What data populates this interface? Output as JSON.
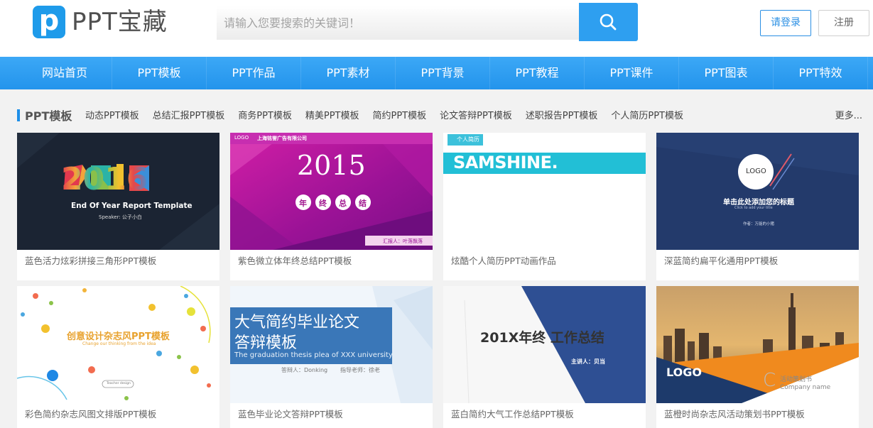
{
  "header": {
    "logo_letter": "p",
    "logo_text": "PPT宝藏",
    "search_placeholder": "请输入您要搜索的关键词！",
    "login_label": "请登录",
    "register_label": "注册"
  },
  "nav": {
    "items": [
      "网站首页",
      "PPT模板",
      "PPT作品",
      "PPT素材",
      "PPT背景",
      "PPT教程",
      "PPT课件",
      "PPT图表",
      "PPT特效"
    ]
  },
  "category": {
    "title": "PPT模板",
    "links": [
      "动态PPT模板",
      "总结汇报PPT模板",
      "商务PPT模板",
      "精美PPT模板",
      "简约PPT模板",
      "论文答辩PPT模板",
      "述职报告PPT模板",
      "个人简历PPT模板"
    ],
    "more": "更多..."
  },
  "cards": [
    {
      "title": "蓝色活力炫彩拼接三角形PPT模板",
      "thumb": {
        "big": "2016",
        "line1": "End Of Year Report Template",
        "line2": "Speaker: 公子小白"
      }
    },
    {
      "title": "紫色微立体年终总结PPT模板",
      "thumb": {
        "logo": "LOGO",
        "company": "上海铭誉广告有限公司",
        "year": "2015",
        "chars": [
          "年",
          "终",
          "总",
          "结"
        ],
        "reporter": "汇报人：叶落飘落"
      }
    },
    {
      "title": "炫酷个人简历PPT动画作品",
      "thumb": {
        "tag": "个人简历",
        "name": "SAMSHINE."
      }
    },
    {
      "title": "深蓝简约扁平化通用PPT模板",
      "thumb": {
        "logo": "LOGO",
        "heading": "单击此处添加您的标题",
        "sub": "Click to add your title",
        "author": "作者：万能的小猪"
      }
    },
    {
      "title": "彩色简约杂志风图文排版PPT模板",
      "thumb": {
        "heading": "创意设计杂志风PPT模板",
        "sub": "Change our thinking from the idea",
        "btn": "Teacher design"
      }
    },
    {
      "title": "蓝色毕业论文答辩PPT模板",
      "thumb": {
        "line1": "大气简约毕业论文",
        "line2": "答辩模板",
        "en": "The graduation thesis plea of XXX university",
        "who": "答辩人：Donking",
        "teacher": "指导老师：徐老"
      }
    },
    {
      "title": "蓝白简约大气工作总结PPT模板",
      "thumb": {
        "heading": "201X年终 工作总结",
        "speaker": "主讲人：贝当"
      }
    },
    {
      "title": "蓝橙时尚杂志风活动策划书PPT模板",
      "thumb": {
        "logo": "LOGO",
        "cn": "活动策划书",
        "en": "Company name",
        "letter": "C"
      }
    }
  ]
}
